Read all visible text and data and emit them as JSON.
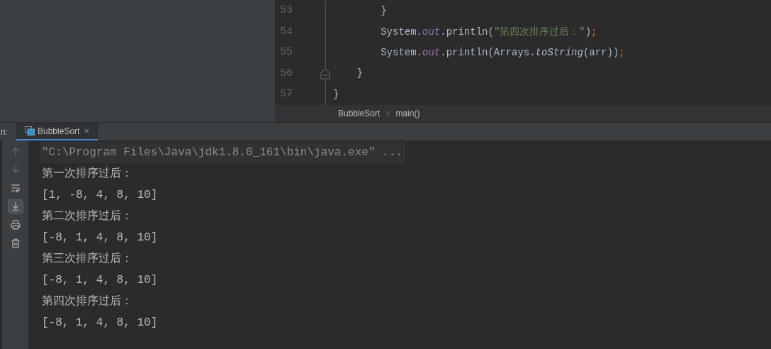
{
  "editor": {
    "lines": [
      {
        "number": "53",
        "fold": false,
        "tokens": [
          {
            "text": "        }",
            "kind": "plain"
          }
        ]
      },
      {
        "number": "54",
        "fold": false,
        "tokens": [
          {
            "text": "        System.",
            "kind": "plain"
          },
          {
            "text": "out",
            "kind": "field"
          },
          {
            "text": ".println(",
            "kind": "plain"
          },
          {
            "text": "\"第四次排序过后：\"",
            "kind": "string"
          },
          {
            "text": ")",
            "kind": "plain"
          },
          {
            "text": ";",
            "kind": "keyword"
          }
        ]
      },
      {
        "number": "55",
        "fold": false,
        "tokens": [
          {
            "text": "        System.",
            "kind": "plain"
          },
          {
            "text": "out",
            "kind": "field"
          },
          {
            "text": ".println(Arrays.",
            "kind": "plain"
          },
          {
            "text": "toString",
            "kind": "static"
          },
          {
            "text": "(arr))",
            "kind": "plain"
          },
          {
            "text": ";",
            "kind": "keyword"
          }
        ]
      },
      {
        "number": "56",
        "fold": true,
        "tokens": [
          {
            "text": "    }",
            "kind": "plain"
          }
        ]
      },
      {
        "number": "57",
        "fold": false,
        "tokens": [
          {
            "text": "}",
            "kind": "plain"
          }
        ]
      }
    ]
  },
  "breadcrumbs": [
    "BubbleSort",
    "main()"
  ],
  "run_panel": {
    "label": "n:",
    "tabs": [
      {
        "label": "BubbleSort",
        "selected": true,
        "close": "×"
      }
    ]
  },
  "toolbar": [
    {
      "kind": "up",
      "selected": false
    },
    {
      "kind": "down",
      "selected": false
    },
    {
      "kind": "wrap",
      "selected": false
    },
    {
      "kind": "scroll",
      "selected": true
    },
    {
      "kind": "print",
      "selected": false
    },
    {
      "kind": "trash",
      "selected": false
    }
  ],
  "console": [
    {
      "text": "\"C:\\Program Files\\Java\\jdk1.8.0_161\\bin\\java.exe\" ...",
      "kind": "command"
    },
    {
      "text": "第一次排序过后：",
      "kind": "output"
    },
    {
      "text": "[1, -8, 4, 8, 10]",
      "kind": "output"
    },
    {
      "text": "第二次排序过后：",
      "kind": "output"
    },
    {
      "text": "[-8, 1, 4, 8, 10]",
      "kind": "output"
    },
    {
      "text": "第三次排序过后：",
      "kind": "output"
    },
    {
      "text": "[-8, 1, 4, 8, 10]",
      "kind": "output"
    },
    {
      "text": "第四次排序过后：",
      "kind": "output"
    },
    {
      "text": "[-8, 1, 4, 8, 10]",
      "kind": "output"
    }
  ]
}
